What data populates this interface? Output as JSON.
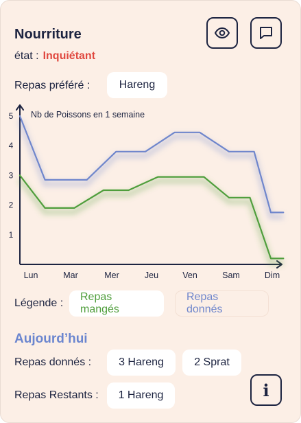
{
  "header": {
    "title": "Nourriture",
    "state_label": "état :",
    "state_value": "Inquiétant",
    "state_color": "#e0483f",
    "actions": [
      {
        "name": "view",
        "icon": "eye-icon"
      },
      {
        "name": "comment",
        "icon": "chat-bubble-icon"
      }
    ]
  },
  "favorite": {
    "label": "Repas préféré :",
    "value": "Hareng"
  },
  "chart_data": {
    "type": "line",
    "title": "Nb de Poissons en 1 semaine",
    "categories": [
      "Lun",
      "Mar",
      "Mer",
      "Jeu",
      "Ven",
      "Sam",
      "Dim"
    ],
    "y_ticks": [
      1,
      2,
      3,
      4,
      5
    ],
    "ylim": [
      0,
      5
    ],
    "series": [
      {
        "name": "Repas donnés",
        "color": "#6f86cc",
        "points": [
          [
            0,
            5
          ],
          [
            0.6,
            2.85
          ],
          [
            1.6,
            2.85
          ],
          [
            2.3,
            3.8
          ],
          [
            3.0,
            3.8
          ],
          [
            3.7,
            4.45
          ],
          [
            4.3,
            4.45
          ],
          [
            5.0,
            3.8
          ],
          [
            5.6,
            3.8
          ],
          [
            6.0,
            1.75
          ],
          [
            6.3,
            1.75
          ]
        ]
      },
      {
        "name": "Repas mangés",
        "color": "#4f9e3c",
        "points": [
          [
            0,
            3
          ],
          [
            0.6,
            1.9
          ],
          [
            1.3,
            1.9
          ],
          [
            2.0,
            2.5
          ],
          [
            2.6,
            2.5
          ],
          [
            3.3,
            2.95
          ],
          [
            4.4,
            2.95
          ],
          [
            5.0,
            2.25
          ],
          [
            5.5,
            2.25
          ],
          [
            6.0,
            0.2
          ],
          [
            6.3,
            0.2
          ]
        ]
      }
    ],
    "grid": false
  },
  "legend": {
    "label": "Légende :",
    "items": [
      {
        "label": "Repas mangés",
        "color": "#4f9e3c"
      },
      {
        "label": "Repas donnés",
        "color": "#6f86cc"
      }
    ]
  },
  "today": {
    "title": "Aujourd’hui",
    "given_label": "Repas donnés :",
    "given": [
      "3 Hareng",
      "2 Sprat"
    ],
    "remaining_label": "Repas Restants :",
    "remaining": [
      "1 Hareng"
    ],
    "info_icon": "info-icon",
    "info_glyph": "i"
  }
}
